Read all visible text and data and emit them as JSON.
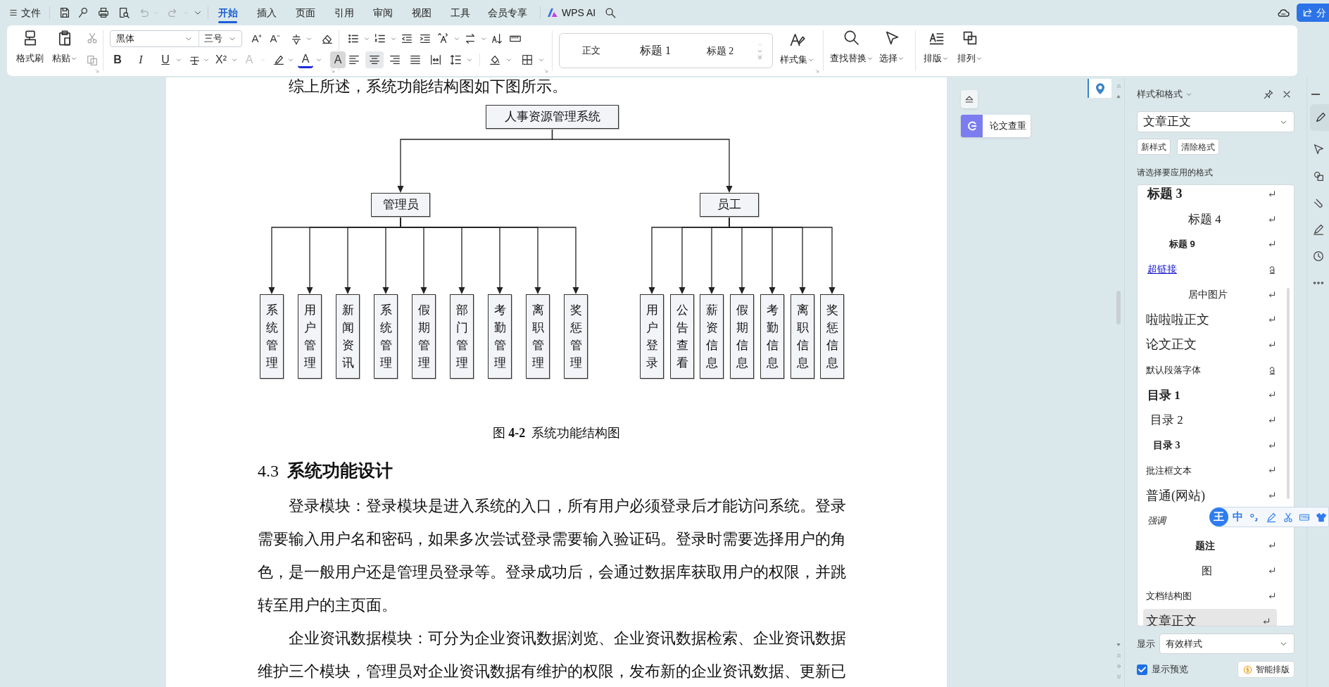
{
  "top_bar": {
    "file_menu": "文件",
    "tabs": [
      {
        "label": "开始",
        "selected": true
      },
      {
        "label": "插入",
        "selected": false
      },
      {
        "label": "页面",
        "selected": false
      },
      {
        "label": "引用",
        "selected": false
      },
      {
        "label": "审阅",
        "selected": false
      },
      {
        "label": "视图",
        "selected": false
      },
      {
        "label": "工具",
        "selected": false
      },
      {
        "label": "会员专享",
        "selected": false
      }
    ],
    "ai_button": "WPS AI",
    "share_button": "分"
  },
  "ribbon": {
    "format_painter": "格式刷",
    "paste": "粘贴",
    "font_name": "黑体",
    "font_size": "三号",
    "size_buttons": [
      "A⁺",
      "A⁻"
    ],
    "format_buttons": [
      {
        "label": "B",
        "kind": "bold",
        "disabled": false
      },
      {
        "label": "I",
        "kind": "italic",
        "disabled": false
      },
      {
        "label": "U",
        "kind": "underline",
        "disabled": false
      },
      {
        "label": "X²",
        "kind": "superscript",
        "disabled": false
      },
      {
        "label": "A",
        "kind": "outline",
        "disabled": true
      },
      {
        "label": "A",
        "kind": "color",
        "disabled": false
      },
      {
        "label": "A",
        "kind": "shade",
        "disabled": false
      }
    ],
    "alignment": [
      {
        "selected": false
      },
      {
        "selected": true
      },
      {
        "selected": false
      },
      {
        "selected": false
      },
      {
        "selected": false
      }
    ],
    "style_gallery": [
      "正文",
      "标题 1",
      "标题 2"
    ],
    "style_set": "样式集",
    "find_replace": "查找替换",
    "select": "选择",
    "layout": "排版",
    "arrange": "排列"
  },
  "side_tools": {
    "plagiarism_check": "论文查重"
  },
  "document": {
    "intro": "综上所述，系统功能结构图如下图所示。",
    "diagram": {
      "label": "人事资源管理系统",
      "children": [
        {
          "label": "管理员",
          "children": [
            {
              "label": "系统管理"
            },
            {
              "label": "用户管理"
            },
            {
              "label": "新闻资讯"
            },
            {
              "label": "系统管理"
            },
            {
              "label": "假期管理"
            },
            {
              "label": "部门管理"
            },
            {
              "label": "考勤管理"
            },
            {
              "label": "离职管理"
            },
            {
              "label": "奖惩管理"
            }
          ]
        },
        {
          "label": "员工",
          "children": [
            {
              "label": "用户登录"
            },
            {
              "label": "公告查看"
            },
            {
              "label": "薪资信息"
            },
            {
              "label": "假期信息"
            },
            {
              "label": "考勤信息"
            },
            {
              "label": "离职信息"
            },
            {
              "label": "奖惩信息"
            }
          ]
        }
      ]
    },
    "caption": "图 **4-2**  系统功能结构图",
    "heading": {
      "number": "4.3",
      "title": "系统功能设计"
    },
    "paragraphs": [
      "登录模块：登录模块是进入系统的入口，所有用户必须登录后才能访问系统。登录需要输入用户名和密码，如果多次尝试登录需要输入验证码。登录时需要选择用户的角色，是一般用户还是管理员登录等。登录成功后，会通过数据库获取用户的权限，并跳转至用户的主页面。",
      "企业资讯数据模块：可分为企业资讯数据浏览、企业资讯数据检索、企业资讯数据维护三个模块，管理员对企业资讯数据有维护的权限，发布新的企业资讯数据、更新已"
    ]
  },
  "styles_panel": {
    "title": "样式和格式",
    "current_style": "文章正文",
    "buttons": [
      "新样式",
      "清除格式"
    ],
    "prompt": "请选择要应用的格式",
    "styles": [
      {
        "label": "标题 3",
        "kind": "heading3",
        "character": false,
        "selected": false
      },
      {
        "label": "标题 4",
        "kind": "heading4",
        "character": false,
        "selected": false
      },
      {
        "label": "标题 9",
        "kind": "heading9",
        "character": false,
        "selected": false
      },
      {
        "label": "超链接",
        "kind": "link",
        "character": true,
        "selected": false
      },
      {
        "label": "居中图片",
        "kind": "centered",
        "character": false,
        "selected": false
      },
      {
        "label": "啦啦啦正文",
        "kind": "body",
        "character": false,
        "selected": false
      },
      {
        "label": "论文正文",
        "kind": "body",
        "character": false,
        "selected": false
      },
      {
        "label": "默认段落字体",
        "kind": "small",
        "character": true,
        "selected": false
      },
      {
        "label": "目录 1",
        "kind": "toc1",
        "character": false,
        "selected": false
      },
      {
        "label": "目录 2",
        "kind": "toc2",
        "character": false,
        "selected": false
      },
      {
        "label": "目录 3",
        "kind": "toc3",
        "character": false,
        "selected": false
      },
      {
        "label": "批注框文本",
        "kind": "small",
        "character": false,
        "selected": false
      },
      {
        "label": "普通(网站)",
        "kind": "body",
        "character": false,
        "selected": false
      },
      {
        "label": "强调",
        "kind": "emphasis",
        "selected": false
      },
      {
        "label": "题注",
        "kind": "caption",
        "character": false,
        "selected": false
      },
      {
        "label": "图",
        "kind": "figure",
        "character": false,
        "selected": false
      },
      {
        "label": "文档结构图",
        "kind": "small",
        "character": false,
        "selected": false
      },
      {
        "label": "文章正文",
        "kind": "body",
        "character": false,
        "selected": true
      }
    ],
    "show_label": "显示",
    "show_value": "有效样式",
    "show_preview": {
      "label": "显示预览",
      "checked": true
    },
    "smart_layout": "智能排版"
  },
  "ime_toolbar": {
    "logo": "王",
    "mode": "中"
  }
}
